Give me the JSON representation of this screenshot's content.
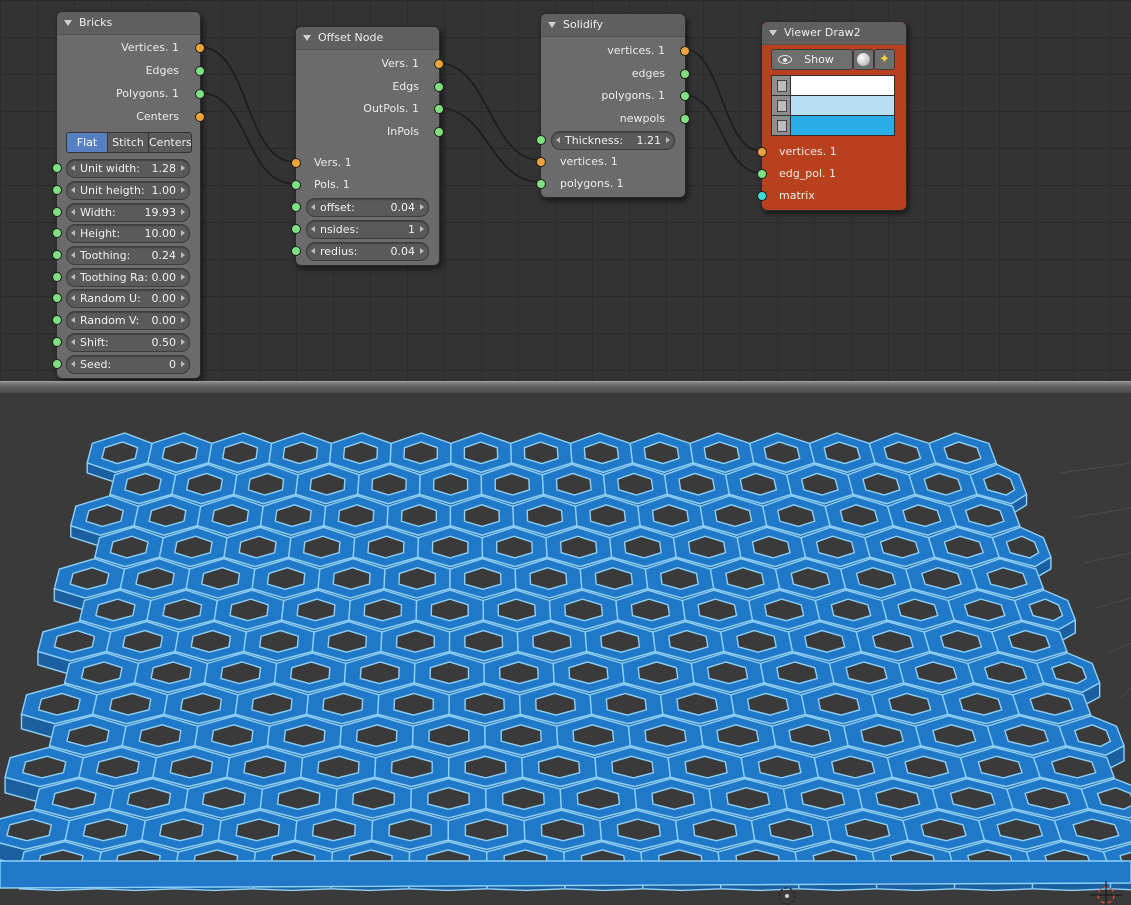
{
  "nodes": {
    "bricks": {
      "title": "Bricks",
      "outputs": [
        "Vertices. 1",
        "Edges",
        "Polygons. 1",
        "Centers"
      ],
      "modes": [
        "Flat",
        "Stitch",
        "Centers"
      ],
      "active_mode": "Flat",
      "fields": [
        {
          "label": "Unit width:",
          "value": "1.28"
        },
        {
          "label": "Unit heigth:",
          "value": "1.00"
        },
        {
          "label": "Width:",
          "value": "19.93"
        },
        {
          "label": "Height:",
          "value": "10.00"
        },
        {
          "label": "Toothing:",
          "value": "0.24"
        },
        {
          "label": "Toothing Ra:",
          "value": "0.00"
        },
        {
          "label": "Random U:",
          "value": "0.00"
        },
        {
          "label": "Random V:",
          "value": "0.00"
        },
        {
          "label": "Shift:",
          "value": "0.50"
        },
        {
          "label": "Seed:",
          "value": "0"
        }
      ]
    },
    "offset": {
      "title": "Offset Node",
      "outputs": [
        "Vers. 1",
        "Edgs",
        "OutPols. 1",
        "InPols"
      ],
      "inputs": [
        "Vers. 1",
        "Pols. 1"
      ],
      "fields": [
        {
          "label": "offset:",
          "value": "0.04"
        },
        {
          "label": "nsides:",
          "value": "1"
        },
        {
          "label": "redius:",
          "value": "0.04"
        }
      ]
    },
    "solidify": {
      "title": "Solidify",
      "outputs": [
        "vertices. 1",
        "edges",
        "polygons. 1",
        "newpols"
      ],
      "thickness": {
        "label": "Thickness:",
        "value": "1.21"
      },
      "inputs": [
        "vertices. 1",
        "polygons. 1"
      ]
    },
    "viewer": {
      "title": "Viewer Draw2",
      "show_label": "Show",
      "colors": [
        "#ffffff",
        "#b8e0f2",
        "#2aaee8"
      ],
      "inputs": [
        "vertices. 1",
        "edg_pol. 1",
        "matrix"
      ]
    }
  },
  "icons": {
    "eye": "eye-icon",
    "sphere": "sphere-icon",
    "wand": "magic-wand-icon",
    "cube": "cube-icon",
    "collapse": "collapse-triangle-icon",
    "origin": "origin-marker-icon",
    "cursor": "3d-cursor-icon"
  },
  "colors": {
    "socket_vertices": "#f0a23a",
    "socket_data": "#7fe07f",
    "socket_matrix": "#3fd8d8",
    "mode_active": "#5680c2",
    "viewer_body": "#b8401c",
    "mesh_face": "#1f78c8",
    "mesh_edge": "#8fd0f5"
  }
}
